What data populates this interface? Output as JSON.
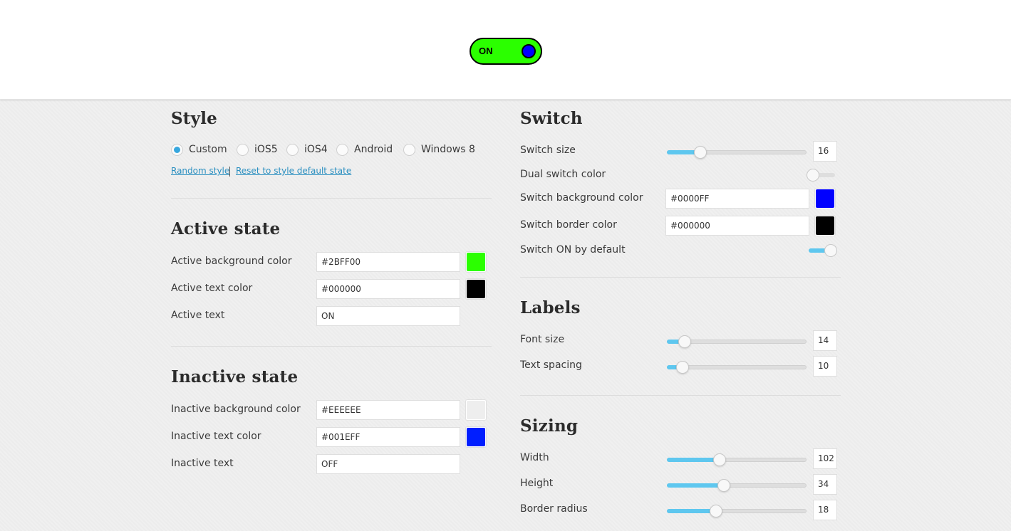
{
  "preview": {
    "label": "ON",
    "background": "#2BFF00",
    "text_color": "#000000",
    "knob_color": "#0000FF",
    "border_color": "#000000"
  },
  "style": {
    "title": "Style",
    "options": [
      {
        "label": "Custom",
        "selected": true
      },
      {
        "label": "iOS5",
        "selected": false
      },
      {
        "label": "iOS4",
        "selected": false
      },
      {
        "label": "Android",
        "selected": false
      },
      {
        "label": "Windows 8",
        "selected": false
      }
    ],
    "random_link": "Random style",
    "reset_link": "Reset to style default state"
  },
  "active": {
    "title": "Active state",
    "bg_label": "Active background color",
    "bg_value": "#2BFF00",
    "text_color_label": "Active text color",
    "text_color_value": "#000000",
    "text_label": "Active text",
    "text_value": "ON"
  },
  "inactive": {
    "title": "Inactive state",
    "bg_label": "Inactive background color",
    "bg_value": "#EEEEEE",
    "text_color_label": "Inactive text color",
    "text_color_value": "#001EFF",
    "text_label": "Inactive text",
    "text_value": "OFF"
  },
  "switch": {
    "title": "Switch",
    "size_label": "Switch size",
    "size_value": "16",
    "size_level": 0.24,
    "dual_label": "Dual switch color",
    "dual_on": false,
    "bg_label": "Switch background color",
    "bg_value": "#0000FF",
    "border_label": "Switch border color",
    "border_value": "#000000",
    "default_on_label": "Switch ON by default",
    "default_on": true
  },
  "labels": {
    "title": "Labels",
    "font_size_label": "Font size",
    "font_size_value": "14",
    "font_size_level": 0.13,
    "spacing_label": "Text spacing",
    "spacing_value": "10",
    "spacing_level": 0.11
  },
  "sizing": {
    "title": "Sizing",
    "width_label": "Width",
    "width_value": "102",
    "width_level": 0.38,
    "height_label": "Height",
    "height_value": "34",
    "height_level": 0.41,
    "radius_label": "Border radius",
    "radius_value": "18",
    "radius_level": 0.35
  },
  "colors": {
    "accent": "#5EC7EF",
    "link": "#2A8FC0"
  }
}
